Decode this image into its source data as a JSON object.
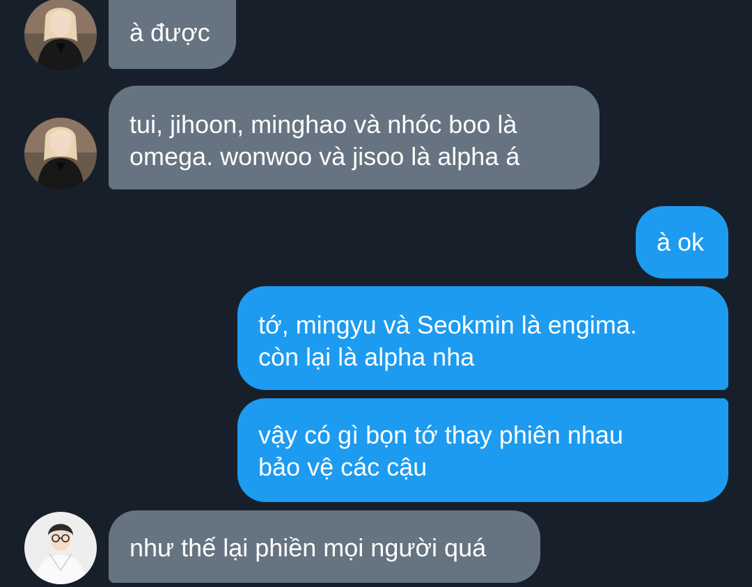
{
  "messages": [
    {
      "text": "à được",
      "side": "incoming",
      "avatar": "avatar-blonde"
    },
    {
      "text": "tui, jihoon, minghao và nhóc boo là\nomega. wonwoo và jisoo là alpha á",
      "side": "incoming",
      "avatar": "avatar-blonde"
    },
    {
      "text": "à ok",
      "side": "outgoing"
    },
    {
      "text": "tớ, mingyu và Seokmin là engima.\ncòn lại là alpha nha",
      "side": "outgoing"
    },
    {
      "text": "vậy có gì bọn tớ thay phiên nhau\nbảo vệ các cậu",
      "side": "outgoing"
    },
    {
      "text": "như thế lại phiền mọi người quá",
      "side": "incoming",
      "avatar": "avatar-glasses"
    }
  ],
  "colors": {
    "background": "#17202a",
    "incoming_bubble": "#667481",
    "outgoing_bubble": "#1d9bf0",
    "text": "#ffffff"
  }
}
